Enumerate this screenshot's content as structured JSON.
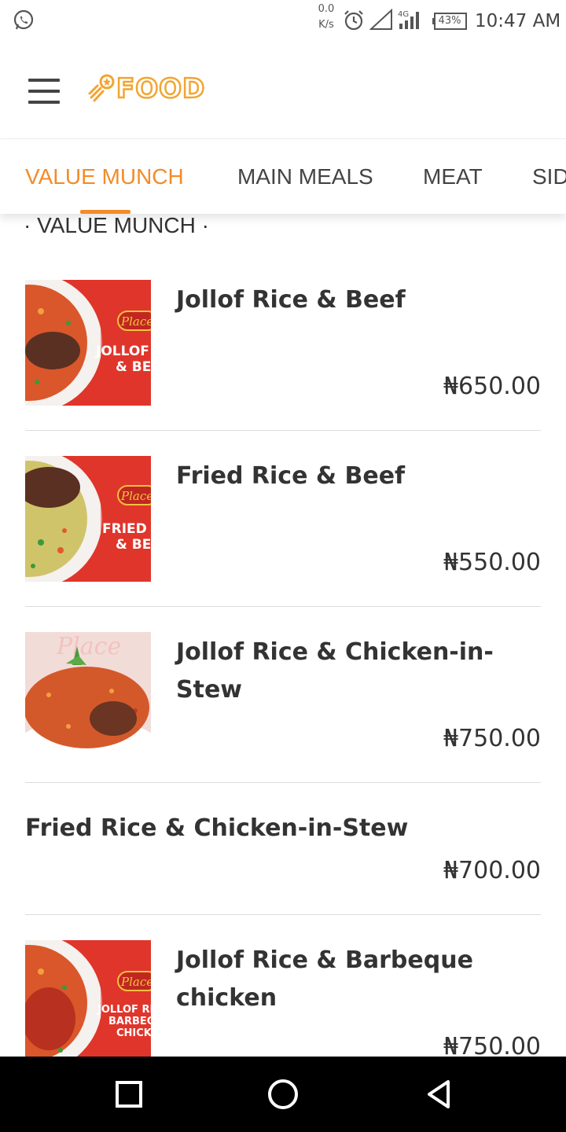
{
  "status_bar": {
    "speed_value": "0.0",
    "speed_unit": "K/s",
    "network": "4G",
    "battery": "43%",
    "time": "10:47 AM"
  },
  "app_bar": {
    "logo_text": "FOOD"
  },
  "colors": {
    "accent": "#f28c2a",
    "logo": "#f2a531",
    "thumb_red": "#e0352b"
  },
  "tabs": [
    {
      "label": "VALUE MUNCH",
      "active": true
    },
    {
      "label": "MAIN MEALS",
      "active": false
    },
    {
      "label": "MEAT",
      "active": false
    },
    {
      "label": "SID",
      "active": false
    }
  ],
  "section": {
    "title": "· VALUE MUNCH ·"
  },
  "menu_items": [
    {
      "name": "Jollof Rice & Beef",
      "price": "₦650.00",
      "has_image": true,
      "image_caption": [
        "JOLLOF",
        "& BE"
      ],
      "image_badge": "Place"
    },
    {
      "name": "Fried Rice & Beef",
      "price": "₦550.00",
      "has_image": true,
      "image_caption": [
        "FRIED",
        "& BE"
      ],
      "image_badge": "Place"
    },
    {
      "name": "Jollof Rice & Chicken-in-Stew",
      "price": "₦750.00",
      "has_image": true,
      "image_caption": [],
      "image_badge": "Place"
    },
    {
      "name": "Fried Rice & Chicken-in-Stew",
      "price": "₦700.00",
      "has_image": false
    },
    {
      "name": "Jollof Rice & Barbeque chicken",
      "price": "₦750.00",
      "has_image": true,
      "image_caption": [
        "JOLLOF RI",
        "BARBEQ",
        "CHICK"
      ],
      "image_badge": "Place"
    }
  ],
  "icons": {
    "status_left": "whatsapp-icon",
    "status_alarm": "alarm-icon",
    "status_signal": "signal-icon",
    "status_battery": "battery-icon",
    "menu": "hamburger-menu-icon",
    "logo_mark": "rocket-star-icon",
    "nav_recents": "square-recents-icon",
    "nav_home": "circle-home-icon",
    "nav_back": "triangle-back-icon"
  }
}
